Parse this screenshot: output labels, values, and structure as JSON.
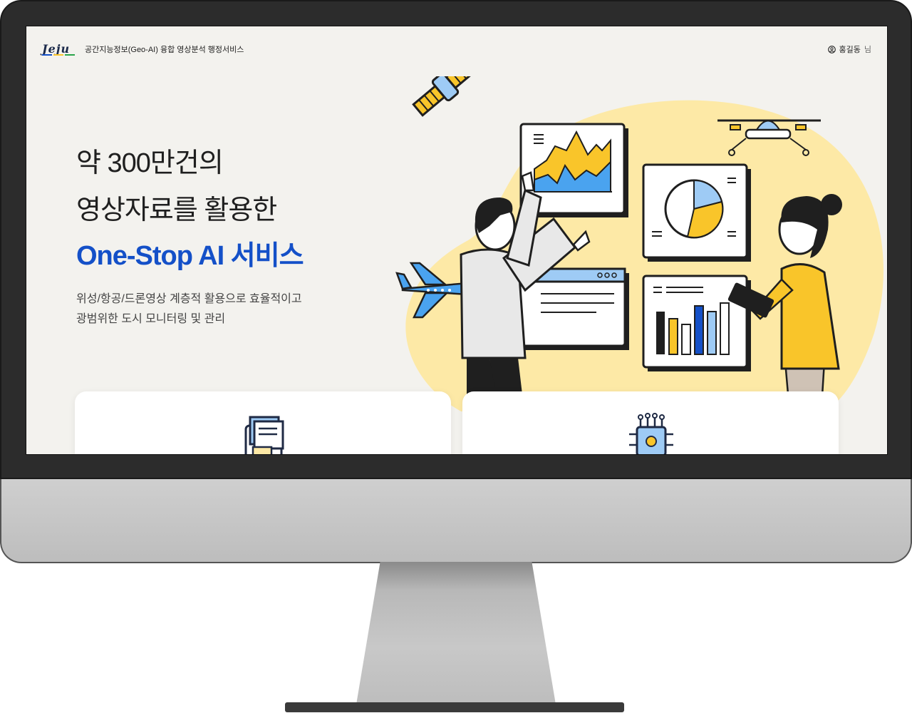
{
  "header": {
    "logo_text": "Jeju",
    "title": "공간지능정보(Geo-AI) 융합 영상분석 행정서비스",
    "user_name": "홍길동",
    "user_suffix": "님"
  },
  "hero": {
    "line1": "약 300만건의",
    "line2": "영상자료를 활용한",
    "line3": "One-Stop AI 서비스",
    "desc1": "위성/항공/드론영상 계층적 활용으로 효율적이고",
    "desc2": "광범위한 도시 모니터링 및 관리"
  },
  "colors": {
    "accent_blue": "#1450c8",
    "accent_yellow": "#f9c52a",
    "light_yellow": "#fde9a6",
    "light_blue": "#9ecbf5",
    "background": "#f3f2ee"
  },
  "cards": [
    {
      "icon": "folder-documents-icon"
    },
    {
      "icon": "ai-chip-icon"
    }
  ]
}
